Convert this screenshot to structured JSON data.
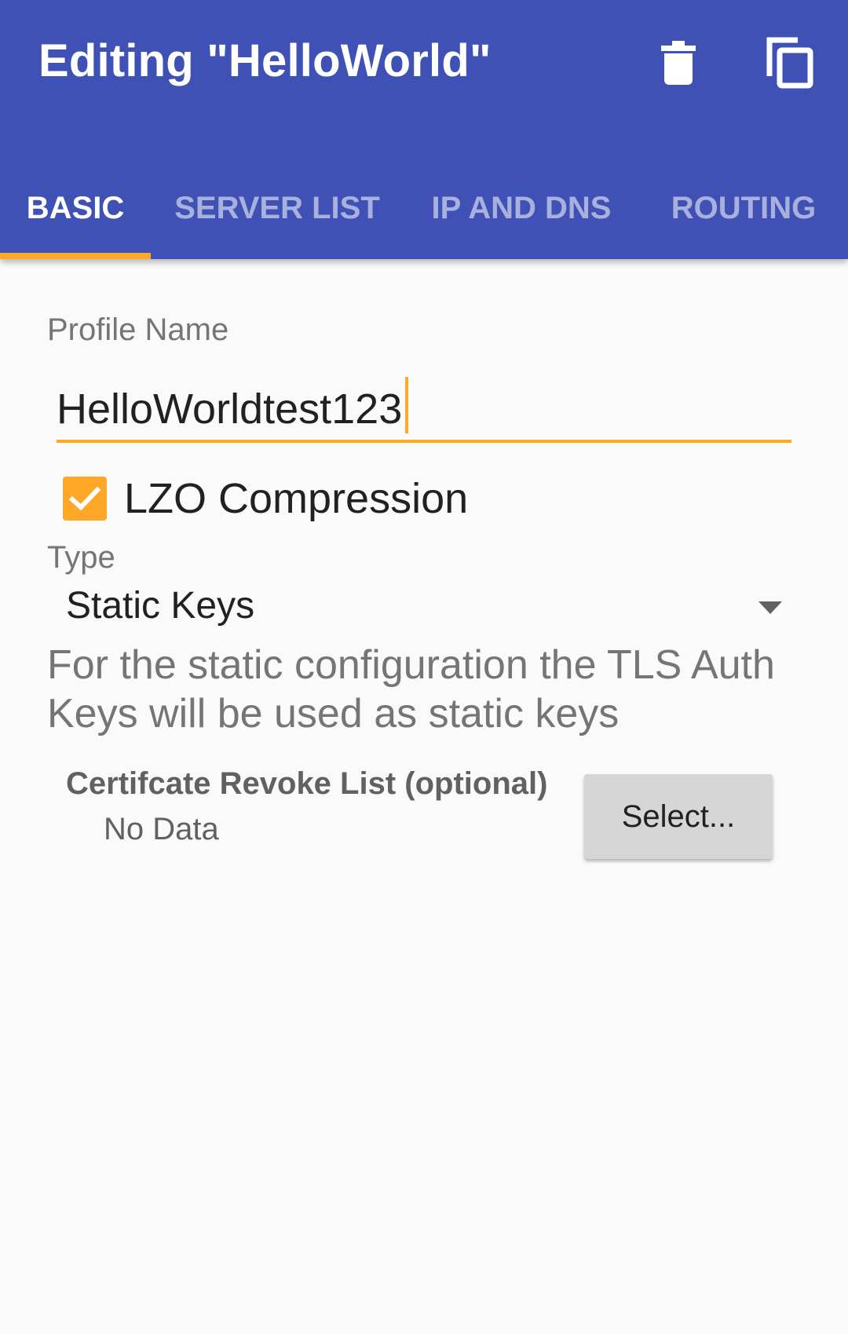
{
  "toolbar": {
    "title": "Editing \"HelloWorld\"",
    "delete_icon": "trash-icon",
    "copy_icon": "copy-icon"
  },
  "tabs": [
    {
      "label": "BASIC",
      "active": true
    },
    {
      "label": "SERVER LIST",
      "active": false
    },
    {
      "label": "IP AND DNS",
      "active": false
    },
    {
      "label": "ROUTING",
      "active": false
    }
  ],
  "form": {
    "profile_name_label": "Profile Name",
    "profile_name_value": "HelloWorldtest123",
    "lzo_label": "LZO Compression",
    "lzo_checked": true,
    "type_label": "Type",
    "type_value": "Static Keys",
    "description": "For the static configuration the TLS Auth Keys will be used as static keys",
    "crl_title": "Certifcate Revoke List (optional)",
    "crl_value": "No Data",
    "select_label": "Select..."
  },
  "colors": {
    "primary": "#3f51b5",
    "accent": "#ffa726",
    "background": "#fafafa"
  }
}
